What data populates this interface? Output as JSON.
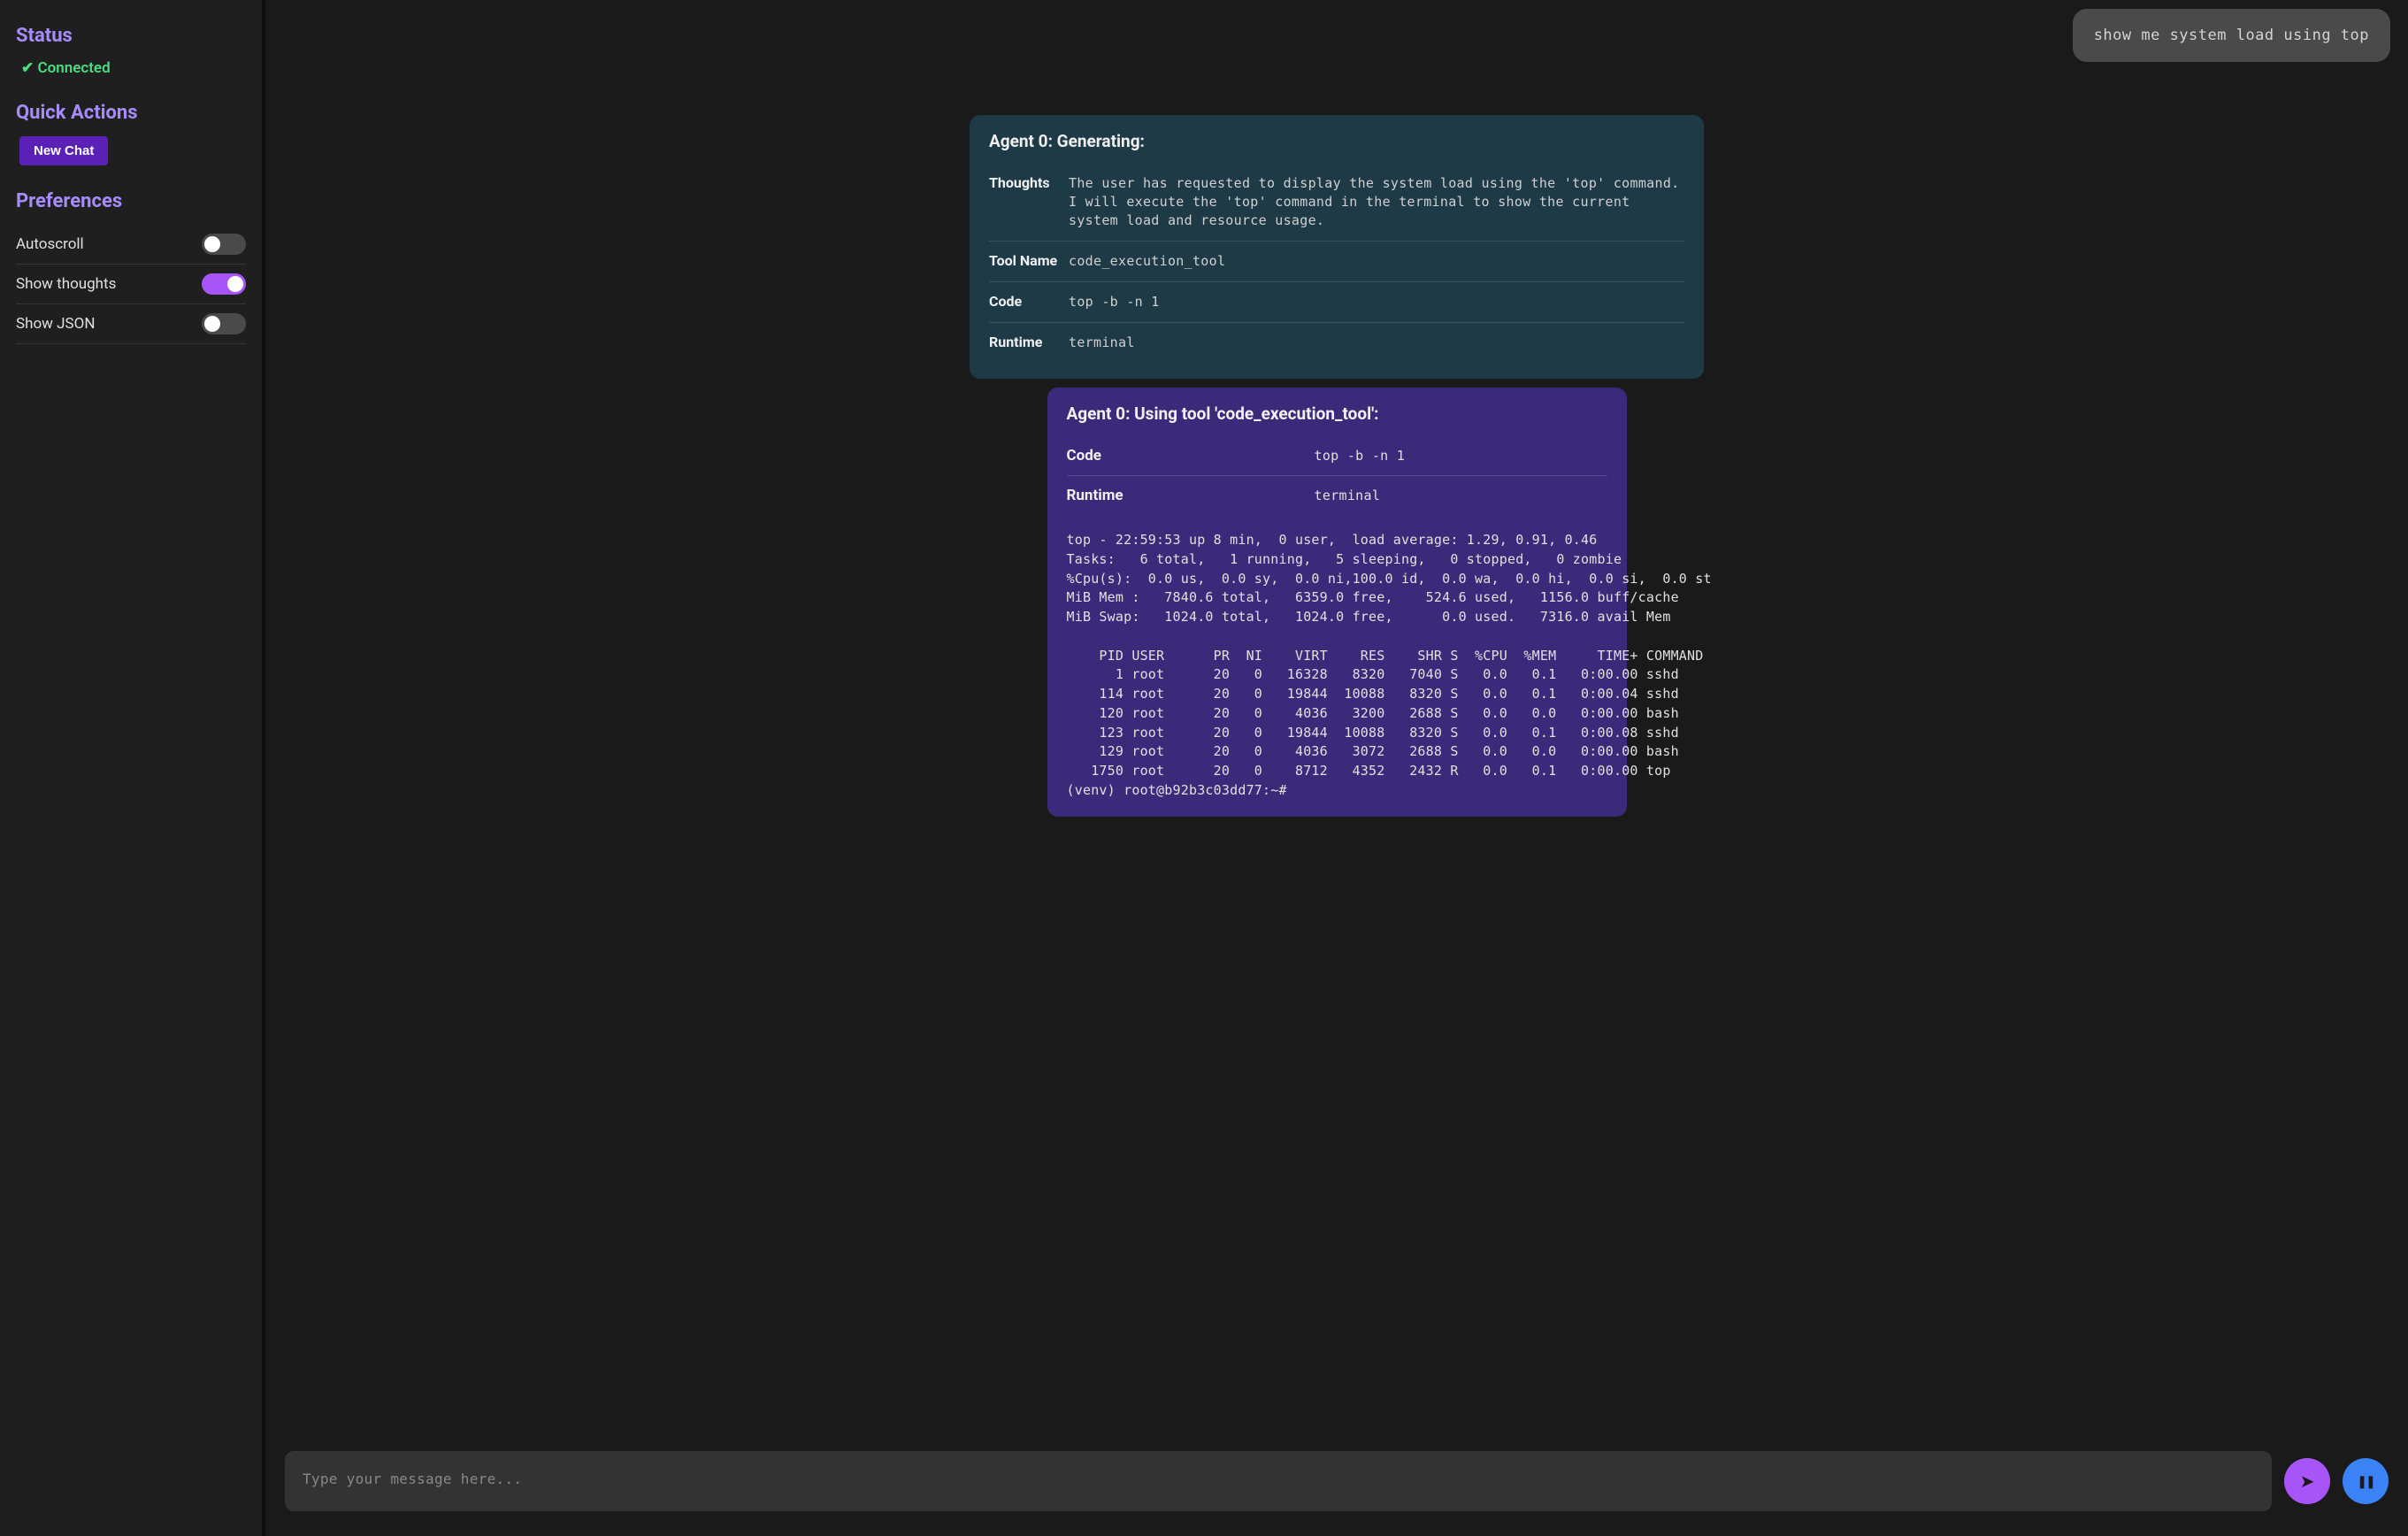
{
  "sidebar": {
    "status_heading": "Status",
    "status_text": "✔ Connected",
    "quick_actions_heading": "Quick Actions",
    "new_chat_label": "New Chat",
    "preferences_heading": "Preferences",
    "prefs": {
      "autoscroll": {
        "label": "Autoscroll",
        "on": false
      },
      "show_thoughts": {
        "label": "Show thoughts",
        "on": true
      },
      "show_json": {
        "label": "Show JSON",
        "on": false
      }
    }
  },
  "chat": {
    "user_message": "show me system load using top",
    "agent_card": {
      "title": "Agent 0: Generating:",
      "labels": {
        "thoughts": "Thoughts",
        "tool_name": "Tool Name",
        "code": "Code",
        "runtime": "Runtime"
      },
      "thoughts": "The user has requested to display the system load using the 'top' command.\nI will execute the 'top' command in the terminal to show the current system load and resource usage.",
      "tool_name": "code_execution_tool",
      "code": "top -b -n 1",
      "runtime": "terminal"
    },
    "tool_card": {
      "title": "Agent 0: Using tool 'code_execution_tool':",
      "labels": {
        "code": "Code",
        "runtime": "Runtime"
      },
      "code": "top -b -n 1",
      "runtime": "terminal",
      "output": "top - 22:59:53 up 8 min,  0 user,  load average: 1.29, 0.91, 0.46\nTasks:   6 total,   1 running,   5 sleeping,   0 stopped,   0 zombie\n%Cpu(s):  0.0 us,  0.0 sy,  0.0 ni,100.0 id,  0.0 wa,  0.0 hi,  0.0 si,  0.0 st\nMiB Mem :   7840.6 total,   6359.0 free,    524.6 used,   1156.0 buff/cache\nMiB Swap:   1024.0 total,   1024.0 free,      0.0 used.   7316.0 avail Mem\n\n    PID USER      PR  NI    VIRT    RES    SHR S  %CPU  %MEM     TIME+ COMMAND\n      1 root      20   0   16328   8320   7040 S   0.0   0.1   0:00.00 sshd\n    114 root      20   0   19844  10088   8320 S   0.0   0.1   0:00.04 sshd\n    120 root      20   0    4036   3200   2688 S   0.0   0.0   0:00.00 bash\n    123 root      20   0   19844  10088   8320 S   0.0   0.1   0:00.08 sshd\n    129 root      20   0    4036   3072   2688 S   0.0   0.0   0:00.00 bash\n   1750 root      20   0    8712   4352   2432 R   0.0   0.1   0:00.00 top\n(venv) root@b92b3c03dd77:~#"
    }
  },
  "input": {
    "placeholder": "Type your message here...",
    "send_icon": "➤",
    "pause_icon": "❚❚"
  }
}
